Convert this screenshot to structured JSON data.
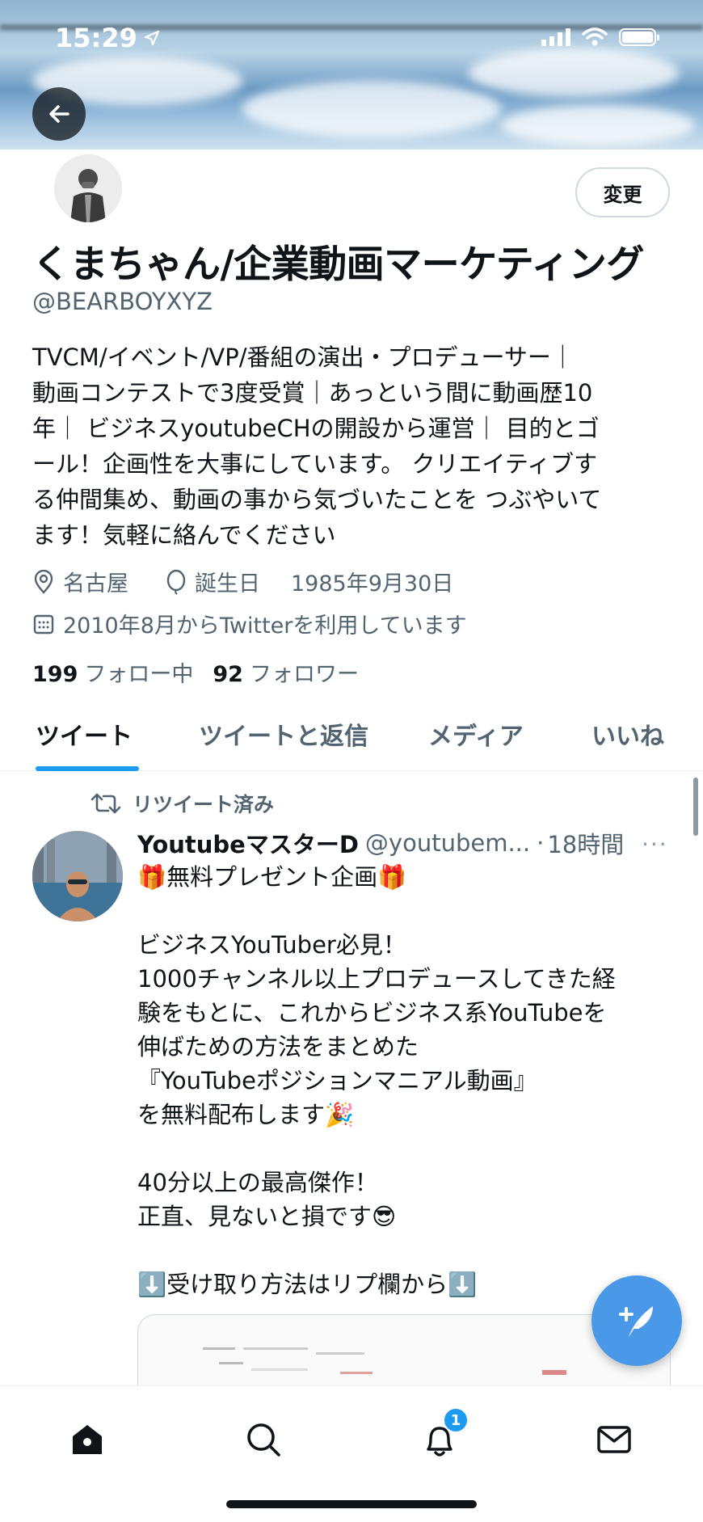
{
  "status_bar": {
    "time": "15:29"
  },
  "profile": {
    "edit_label": "変更",
    "name": "くまちゃん/企業動画マーケティング",
    "handle": "@BEARBOYXYZ",
    "bio_lines": [
      "TVCM/イベント/VP/番組の演出・プロデューサー｜",
      "動画コンテストで3度受賞｜あっという間に動画歴10",
      "年｜ ビジネスyoutubeCHの開設から運営｜ 目的とゴ",
      "ール！企画性を大事にしています。 クリエイティブす",
      "る仲間集め、動画の事から気づいたことを つぶやいて",
      "ます！気軽に絡んでください"
    ],
    "location": "名古屋",
    "birthday_label": "誕生日",
    "birthday": "1985年9月30日",
    "joined": "2010年8月からTwitterを利用しています",
    "following_count": "199",
    "following_label": "フォロー中",
    "followers_count": "92",
    "followers_label": "フォロワー"
  },
  "tabs": [
    {
      "label": "ツイート",
      "active": true
    },
    {
      "label": "ツイートと返信",
      "active": false
    },
    {
      "label": "メディア",
      "active": false
    },
    {
      "label": "いいね",
      "active": false
    }
  ],
  "tweet": {
    "retweet_label": "リツイート済み",
    "author": "YoutubeマスターD",
    "handle": "@youtubem...",
    "separator": "·",
    "time": "18時間",
    "more": "···",
    "body": "🎁無料プレゼント企画🎁\n\nビジネスYouTuber必見！\n1000チャンネル以上プロデュースしてきた経\n験をもとに、これからビジネス系YouTubeを\n伸ばための方法をまとめた\n『YouTubeポジションマニアル動画』\nを無料配布します🎉\n\n40分以上の最高傑作！\n正直、見ないと損です😎\n\n⬇️受け取り方法はリプ欄から⬇️"
  },
  "bottom_nav": {
    "notification_badge": "1"
  },
  "colors": {
    "accent": "#1d9bf0",
    "fab": "#4a99e9",
    "text": "#0f1419",
    "muted": "#536471"
  }
}
